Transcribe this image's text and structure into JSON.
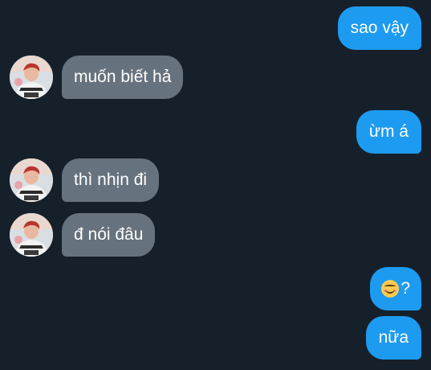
{
  "conversation": {
    "messages": [
      {
        "direction": "outgoing",
        "text": "sao vậy"
      },
      {
        "direction": "incoming",
        "text": "muốn biết hả"
      },
      {
        "direction": "outgoing",
        "text": "ừm á"
      },
      {
        "direction": "incoming",
        "text": "thì nhịn đi"
      },
      {
        "direction": "incoming",
        "text": "đ nói đâu"
      },
      {
        "direction": "outgoing",
        "emoji": "smiling-face-emoji",
        "text": "?"
      },
      {
        "direction": "outgoing",
        "text": "nữa"
      }
    ]
  },
  "colors": {
    "background": "#16202b",
    "outgoing_bubble": "#1d9bf0",
    "incoming_bubble": "#66727e",
    "text": "#ffffff"
  }
}
